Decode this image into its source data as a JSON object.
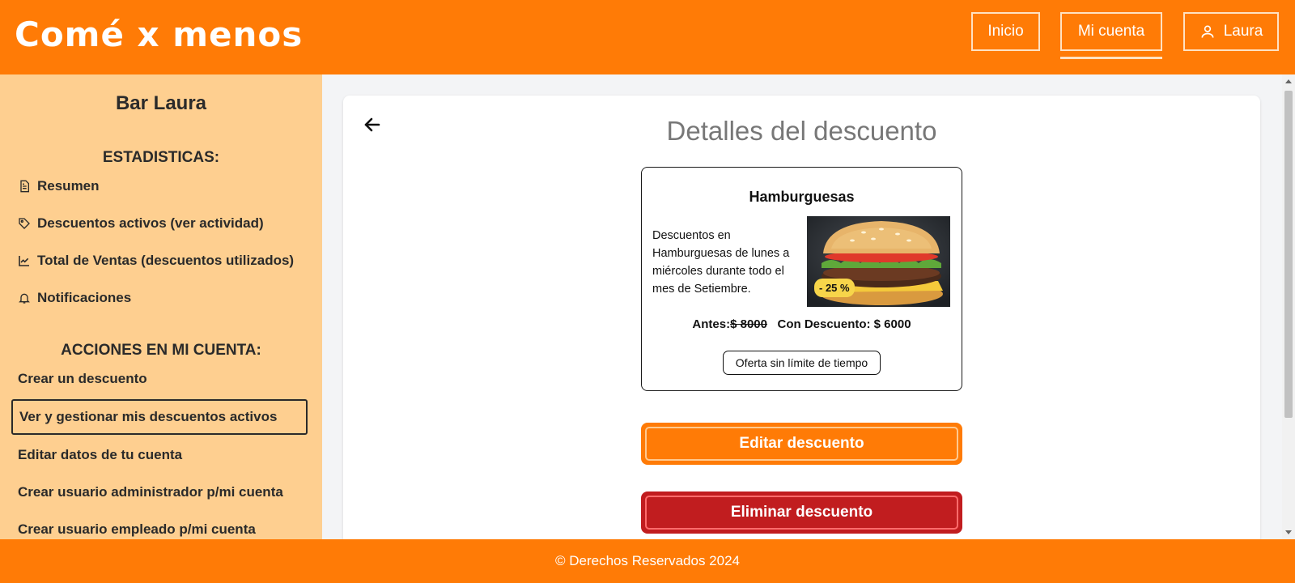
{
  "header": {
    "brand": "Comé x menos",
    "nav": {
      "home": "Inicio",
      "account": "Mi cuenta",
      "user": "Laura"
    }
  },
  "sidebar": {
    "title": "Bar Laura",
    "stats_heading": "ESTADISTICAS:",
    "stats_items": [
      {
        "label": "Resumen",
        "icon": "document-icon"
      },
      {
        "label": "Descuentos activos (ver actividad)",
        "icon": "tag-icon"
      },
      {
        "label": "Total de Ventas (descuentos utilizados)",
        "icon": "chart-line-icon"
      },
      {
        "label": "Notificaciones",
        "icon": "bell-icon"
      }
    ],
    "actions_heading": "ACCIONES EN MI CUENTA:",
    "actions": [
      {
        "label": "Crear un descuento"
      },
      {
        "label": "Ver y gestionar mis descuentos activos",
        "active": true
      },
      {
        "label": "Editar datos de tu cuenta"
      },
      {
        "label": "Crear usuario administrador p/mi cuenta"
      },
      {
        "label": "Crear usuario empleado p/mi cuenta"
      }
    ]
  },
  "main": {
    "title": "Detalles del descuento",
    "discount": {
      "name": "Hamburguesas",
      "description": "Descuentos en Hamburguesas de lunes a miércoles durante todo el mes de Setiembre.",
      "badge": "- 25 %",
      "before_label": "Antes:",
      "before_price": "$ 8000",
      "after_label": "Con Descuento: $ 6000",
      "validity": "Oferta sin límite de tiempo"
    },
    "edit_button": "Editar descuento",
    "delete_button": "Eliminar descuento"
  },
  "footer": {
    "text": "© Derechos Reservados 2024"
  },
  "colors": {
    "brand": "#ff7b06",
    "sidebar": "#fecf90",
    "danger": "#c11d1f",
    "badge": "#f7d54a"
  }
}
